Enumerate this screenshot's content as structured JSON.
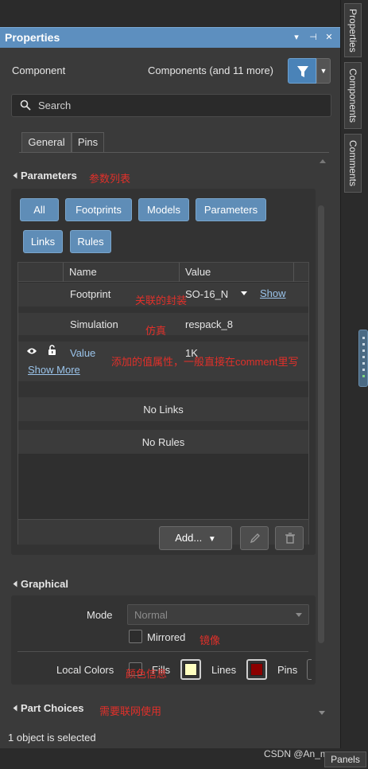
{
  "header": {
    "title": "Properties",
    "dropdown_glyph": "▾",
    "pin_glyph": "⊣",
    "close_glyph": "✕"
  },
  "side_tabs": [
    "Properties",
    "Components",
    "Comments"
  ],
  "component": {
    "label": "Component",
    "filter_text": "Components (and 11 more)"
  },
  "search": {
    "placeholder": "Search"
  },
  "tabs": [
    {
      "label": "General",
      "active": true
    },
    {
      "label": "Pins",
      "active": false
    }
  ],
  "parameters": {
    "heading": "Parameters",
    "annotation": "参数列表",
    "filters": [
      "All",
      "Footprints",
      "Models",
      "Parameters",
      "Links",
      "Rules"
    ],
    "columns": {
      "name": "Name",
      "value": "Value"
    },
    "rows": [
      {
        "name": "Footprint",
        "value": "SO-16_N",
        "link": "Show",
        "annotation": "关联的封装"
      },
      {
        "name": "Simulation",
        "value": "respack_8",
        "annotation": "仿真"
      },
      {
        "name": "Value",
        "value": "1K",
        "link": "Show More",
        "annotation": "添加的值属性，一般直接在comment里写"
      }
    ],
    "no_links": "No Links",
    "no_rules": "No Rules",
    "add_button": "Add...",
    "add_arrow": "▼"
  },
  "graphical": {
    "heading": "Graphical",
    "mode_label": "Mode",
    "mode_value": "Normal",
    "mirrored_label": "Mirrored",
    "mirrored_annotation": "镜像",
    "local_colors_label": "Local Colors",
    "local_colors_annotation": "颜色信息",
    "fills_label": "Fills",
    "lines_label": "Lines",
    "pins_label": "Pins",
    "lines_color": "#ffffc0",
    "pins_color": "#8b0000"
  },
  "part_choices": {
    "heading": "Part Choices",
    "annotation": "需要联网使用"
  },
  "status": {
    "text": "1 object is selected"
  },
  "bottom": {
    "panels": "Panels",
    "watermark": "CSDN @An_muyan"
  },
  "colors": {
    "accent": "#5d8fbf",
    "pill": "#5f8db7",
    "annotation": "#e0302a"
  }
}
